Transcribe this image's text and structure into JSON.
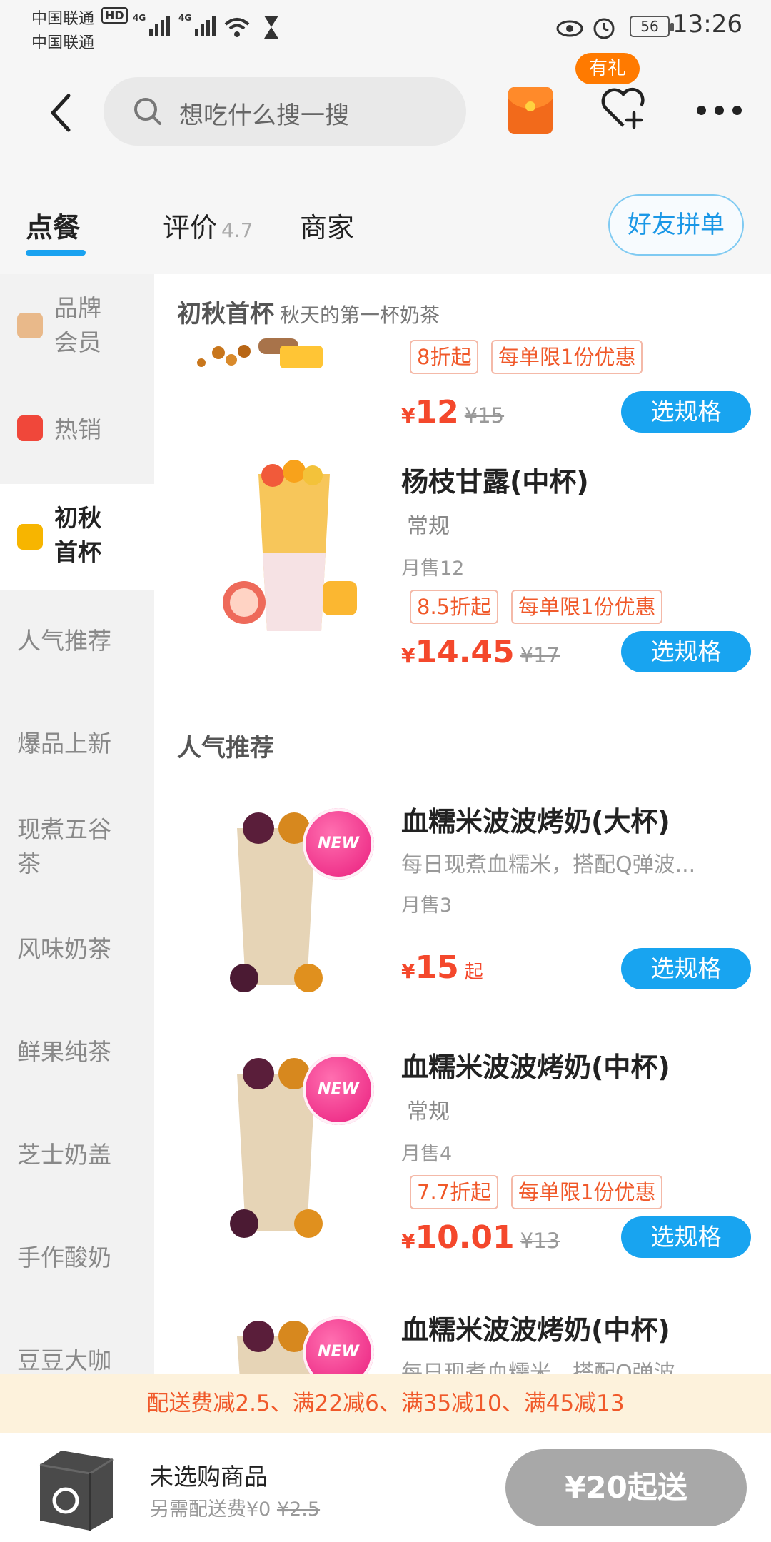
{
  "status_bar": {
    "carrier1": "中国联通",
    "carrier1_badge": "HD",
    "carrier2": "中国联通",
    "network1": "4G",
    "network2": "4G",
    "battery": "56",
    "time": "13:26"
  },
  "header": {
    "search_placeholder": "想吃什么搜一搜",
    "gift_badge": "有礼"
  },
  "tabs": {
    "order": "点餐",
    "reviews": "评价",
    "rating": "4.7",
    "merchant": "商家",
    "group_order": "好友拼单",
    "accent": "#1aa2f0"
  },
  "sidebar": {
    "items": [
      {
        "label": "品牌\n会员",
        "icon": "diamond-icon"
      },
      {
        "label": "热销",
        "icon": "fire-icon"
      },
      {
        "label": "初秋\n首杯",
        "icon": "tag-icon"
      },
      {
        "label": "人气推荐"
      },
      {
        "label": "爆品上新"
      },
      {
        "label": "现煮五谷\n茶"
      },
      {
        "label": "风味奶茶"
      },
      {
        "label": "鲜果纯茶"
      },
      {
        "label": "芝士奶盖"
      },
      {
        "label": "手作酸奶"
      },
      {
        "label": "豆豆大咖"
      }
    ]
  },
  "sections": {
    "autumn": {
      "title": "初秋首杯",
      "subtitle": "秋天的第一杯奶茶"
    },
    "popular": {
      "title": "人气推荐"
    }
  },
  "items": [
    {
      "tags": [
        "8折起",
        "每单限1份优惠"
      ],
      "yen": "¥",
      "price": "12",
      "orig": "¥15",
      "button": "选规格"
    },
    {
      "name": "杨枝甘露(中杯)",
      "spec": "常规",
      "sold": "月售12",
      "tags": [
        "8.5折起",
        "每单限1份优惠"
      ],
      "yen": "¥",
      "price": "14.45",
      "orig": "¥17",
      "button": "选规格"
    },
    {
      "name": "血糯米波波烤奶(大杯)",
      "badge": "NEW",
      "desc": "每日现煮血糯米，搭配Q弹波...",
      "sold": "月售3",
      "yen": "¥",
      "price": "15",
      "suffix": "起",
      "button": "选规格"
    },
    {
      "name": "血糯米波波烤奶(中杯)",
      "badge": "NEW",
      "spec": "常规",
      "sold": "月售4",
      "tags": [
        "7.7折起",
        "每单限1份优惠"
      ],
      "yen": "¥",
      "price": "10.01",
      "orig": "¥13",
      "button": "选规格"
    },
    {
      "name": "血糯米波波烤奶(中杯)",
      "badge": "NEW",
      "desc": "每日现煮血糯米，搭配Q弹波..."
    }
  ],
  "promo": "配送费减2.5、满22减6、满35减10、满45减13",
  "cart": {
    "status": "未选购商品",
    "delivery_prefix": "另需配送费¥0",
    "delivery_orig": "¥2.5",
    "min_order": "¥20起送"
  }
}
